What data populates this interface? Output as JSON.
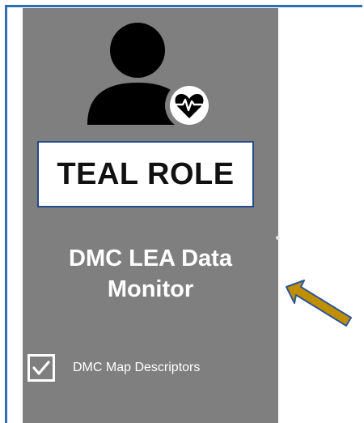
{
  "card": {
    "role_label": "TEAL ROLE",
    "title_line1": "DMC LEA Data",
    "title_line2": "Monitor",
    "option": {
      "label": "DMC Map Descriptors",
      "checked": true
    }
  },
  "icons": {
    "person": "person-health-icon",
    "checkbox": "checkbox-checked-icon",
    "arrow": "pointer-arrow-icon"
  },
  "colors": {
    "card_background": "#7f7f7f",
    "frame_accent": "#2f6fb5",
    "badge_border": "#234a8a",
    "arrow_fill": "#bf8f00",
    "arrow_outline": "#2e5597"
  }
}
